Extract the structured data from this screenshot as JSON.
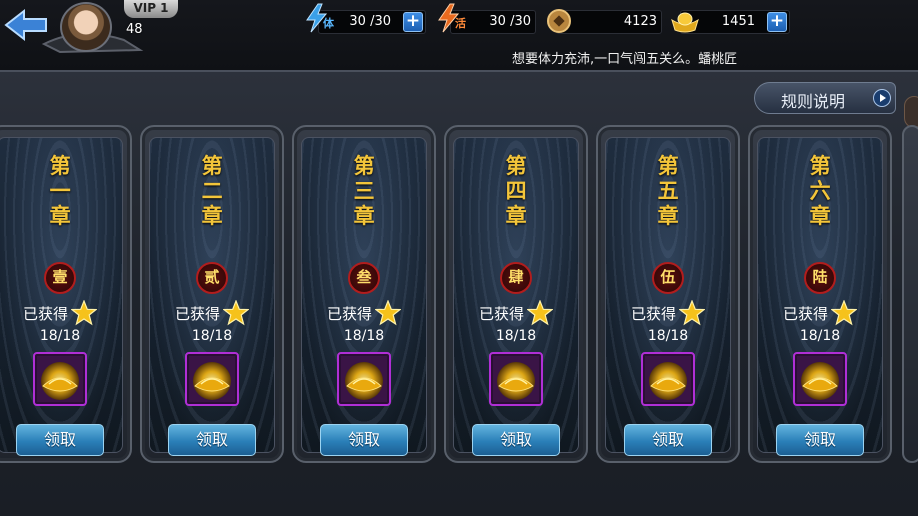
{
  "header": {
    "vip_label": "VIP 1",
    "player_level": "48",
    "stamina": {
      "icon": "stamina-lightning-icon",
      "char": "体",
      "value": "30 /30"
    },
    "activity": {
      "icon": "activity-lightning-icon",
      "char": "活",
      "value": "30 /30"
    },
    "copper": {
      "icon": "copper-coin-icon",
      "value": "4123"
    },
    "gold": {
      "icon": "gold-ingot-icon",
      "value": "1451"
    },
    "notice": "想要体力充沛,一口气闯五关么。蟠桃匠"
  },
  "rules_button": "规则说明",
  "colors": {
    "chapter_gold": "#f3c53a",
    "claim_blue": "#2a7fb8",
    "reward_frame": "#b02fd6",
    "seal_red": "#b21d1d"
  },
  "chapters": [
    {
      "title": "第一章",
      "seal": "壹",
      "status": "已获得",
      "count": "18/18",
      "button": "领取"
    },
    {
      "title": "第二章",
      "seal": "贰",
      "status": "已获得",
      "count": "18/18",
      "button": "领取"
    },
    {
      "title": "第三章",
      "seal": "叁",
      "status": "已获得",
      "count": "18/18",
      "button": "领取"
    },
    {
      "title": "第四章",
      "seal": "肆",
      "status": "已获得",
      "count": "18/18",
      "button": "领取"
    },
    {
      "title": "第五章",
      "seal": "伍",
      "status": "已获得",
      "count": "18/18",
      "button": "领取"
    },
    {
      "title": "第六章",
      "seal": "陆",
      "status": "已获得",
      "count": "18/18",
      "button": "领取"
    }
  ]
}
